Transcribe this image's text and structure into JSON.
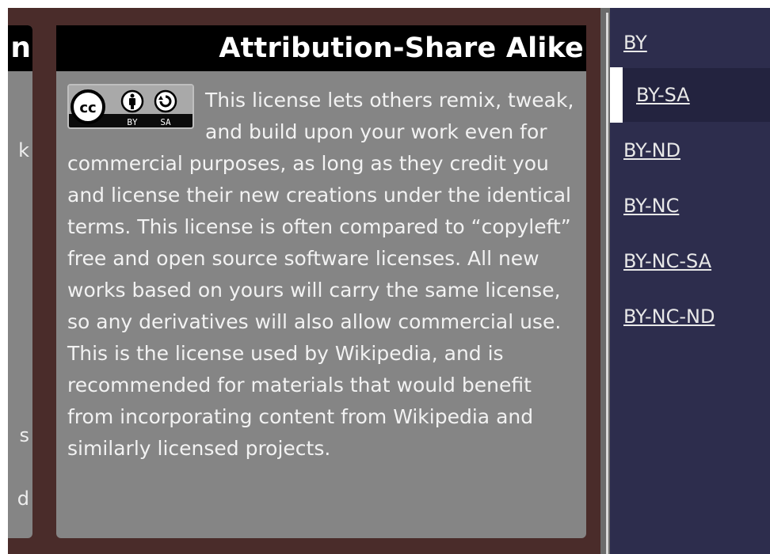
{
  "prev_card": {
    "title_fragment": "n",
    "text_fragments": [
      "k",
      "s",
      "d"
    ]
  },
  "main_card": {
    "title": "Attribution-Share Alike",
    "badge": {
      "icon": "cc-by-sa-badge",
      "left_label": "BY",
      "right_label": "SA",
      "cc_label": "cc"
    },
    "description": "This license lets others remix, tweak, and build upon your work even for commercial purposes, as long as they credit you and license their new creations under the identical terms. This license is often compared to “copyleft” free and open source software licenses. All new works based on yours will carry the same license, so any derivatives will also allow commercial use. This is the license used by Wikipedia, and is recommended for materials that would benefit from incorporating content from Wikipedia and similarly licensed projects."
  },
  "sidebar": {
    "items": [
      {
        "label": "BY"
      },
      {
        "label": "BY-SA"
      },
      {
        "label": "BY-ND"
      },
      {
        "label": "BY-NC"
      },
      {
        "label": "BY-NC-SA"
      },
      {
        "label": "BY-NC-ND"
      }
    ],
    "active": "BY-SA"
  },
  "colors": {
    "background": "#4a2c2a",
    "card": "#858585",
    "title_bar": "#000000",
    "sidebar": "#2d2d4d",
    "sidebar_active": "#23233f",
    "text": "#f2f2f2"
  }
}
